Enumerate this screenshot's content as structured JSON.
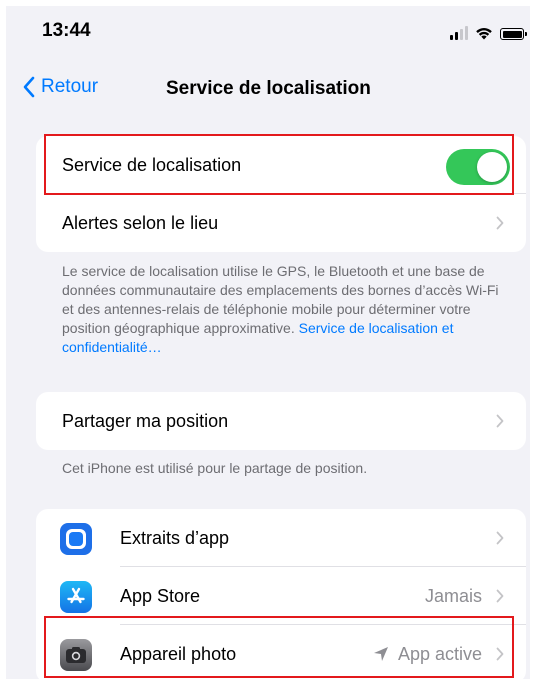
{
  "status": {
    "time": "13:44"
  },
  "nav": {
    "back_label": "Retour",
    "title": "Service de localisation"
  },
  "location_group": {
    "service_label": "Service de localisation",
    "service_enabled": true,
    "alerts_label": "Alertes selon le lieu"
  },
  "info_text": "Le service de localisation utilise le GPS, le Bluetooth et une base de données communautaire des emplacements des bornes d’accès Wi-Fi et des antennes-relais de téléphonie mobile pour déterminer votre position géographique approximative.",
  "info_link": "Service de localisation et confidentialité…",
  "share_group": {
    "share_label": "Partager ma position"
  },
  "share_note": "Cet iPhone est utilisé pour le partage de position.",
  "apps": [
    {
      "name": "Extraits d’app",
      "value": "",
      "icon": "app-clips-icon"
    },
    {
      "name": "App Store",
      "value": "Jamais",
      "icon": "app-store-icon"
    },
    {
      "name": "Appareil photo",
      "value": "App active",
      "icon": "camera-icon"
    }
  ],
  "colors": {
    "accent": "#007aff",
    "toggle_on": "#34c759",
    "highlight": "#e3191c",
    "background": "#f2f2f7"
  }
}
